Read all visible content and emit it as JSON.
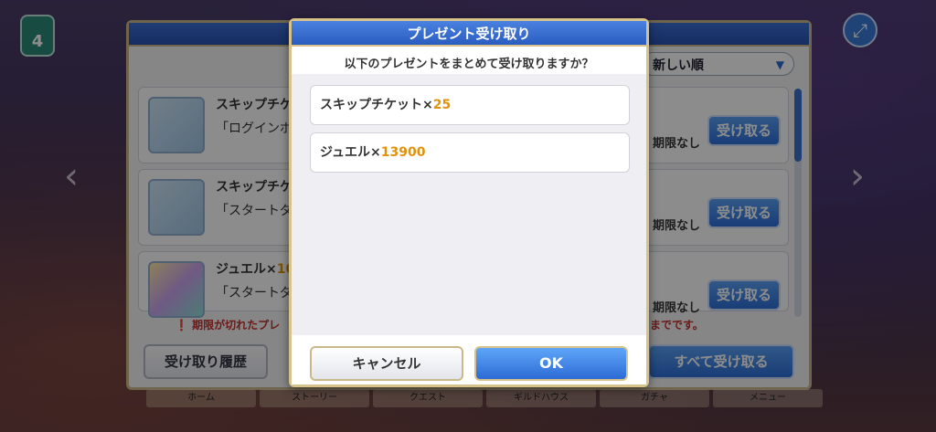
{
  "hud": {
    "badge_value": "4"
  },
  "present_box": {
    "sort_label": "新しい順",
    "items": [
      {
        "name": "スキップチケッ",
        "qty": "",
        "desc": "「ログインボ",
        "limit": "期限なし",
        "receive_label": "受け取る",
        "icon": "ticket-icon"
      },
      {
        "name": "スキップチケッ",
        "qty": "",
        "desc": "「スタートダ",
        "limit": "期限なし",
        "receive_label": "受け取る",
        "icon": "ticket-icon"
      },
      {
        "name": "ジュエル×",
        "qty": "10",
        "desc": "「スタートダ",
        "limit": "期限なし",
        "receive_label": "受け取る",
        "icon": "jewel-icon"
      }
    ],
    "notice": "期限が切れたプレ",
    "notice_tail": "までです。",
    "history_label": "受け取り履歴",
    "receive_all_label": "すべて受け取る",
    "nav_tabs": [
      "ホーム",
      "ストーリー",
      "クエスト",
      "ギルドハウス",
      "ガチャ",
      "メニュー"
    ]
  },
  "dialog": {
    "title": "プレゼント受け取り",
    "question": "以下のプレゼントをまとめて受け取りますか？",
    "items": [
      {
        "name": "スキップチケット×",
        "qty": "25"
      },
      {
        "name": "ジュエル×",
        "qty": "13900"
      }
    ],
    "cancel_label": "キャンセル",
    "ok_label": "OK"
  },
  "colors": {
    "accent_blue": "#2e6fd8",
    "qty_orange": "#e0920c",
    "frame_gold": "#d6c28a",
    "notice_red": "#c4302c"
  }
}
